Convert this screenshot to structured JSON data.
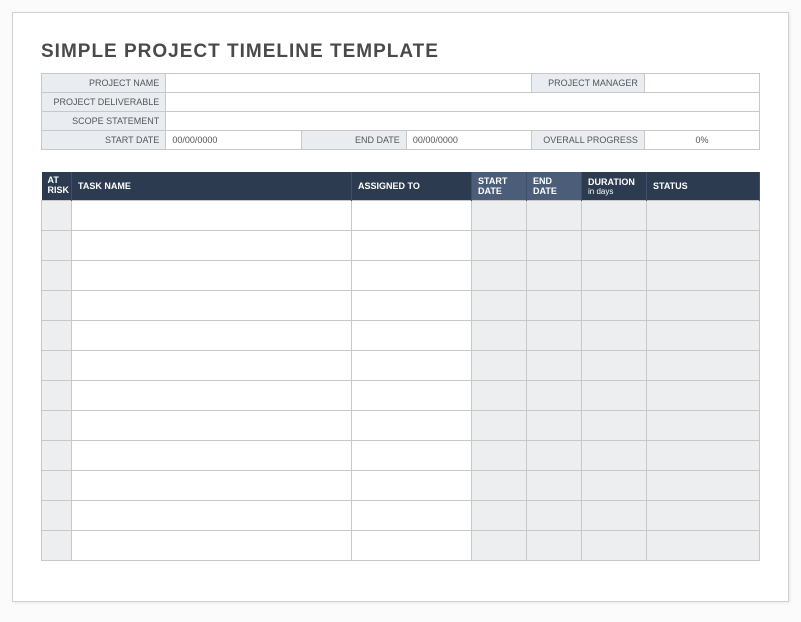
{
  "title": "SIMPLE PROJECT TIMELINE TEMPLATE",
  "info": {
    "project_name_label": "PROJECT NAME",
    "project_name_value": "",
    "project_manager_label": "PROJECT MANAGER",
    "project_manager_value": "",
    "deliverable_label": "PROJECT DELIVERABLE",
    "deliverable_value": "",
    "scope_label": "SCOPE STATEMENT",
    "scope_value": "",
    "start_date_label": "START DATE",
    "start_date_value": "00/00/0000",
    "end_date_label": "END DATE",
    "end_date_value": "00/00/0000",
    "progress_label": "OVERALL PROGRESS",
    "progress_value": "0%"
  },
  "task_headers": {
    "at_risk": "AT RISK",
    "task_name": "TASK NAME",
    "assigned_to": "ASSIGNED TO",
    "start_date": "START DATE",
    "end_date": "END DATE",
    "duration": "DURATION",
    "duration_sub": "in days",
    "status": "STATUS"
  },
  "task_rows": [
    {
      "at_risk": "",
      "task_name": "",
      "assigned_to": "",
      "start_date": "",
      "end_date": "",
      "duration": "",
      "status": ""
    },
    {
      "at_risk": "",
      "task_name": "",
      "assigned_to": "",
      "start_date": "",
      "end_date": "",
      "duration": "",
      "status": ""
    },
    {
      "at_risk": "",
      "task_name": "",
      "assigned_to": "",
      "start_date": "",
      "end_date": "",
      "duration": "",
      "status": ""
    },
    {
      "at_risk": "",
      "task_name": "",
      "assigned_to": "",
      "start_date": "",
      "end_date": "",
      "duration": "",
      "status": ""
    },
    {
      "at_risk": "",
      "task_name": "",
      "assigned_to": "",
      "start_date": "",
      "end_date": "",
      "duration": "",
      "status": ""
    },
    {
      "at_risk": "",
      "task_name": "",
      "assigned_to": "",
      "start_date": "",
      "end_date": "",
      "duration": "",
      "status": ""
    },
    {
      "at_risk": "",
      "task_name": "",
      "assigned_to": "",
      "start_date": "",
      "end_date": "",
      "duration": "",
      "status": ""
    },
    {
      "at_risk": "",
      "task_name": "",
      "assigned_to": "",
      "start_date": "",
      "end_date": "",
      "duration": "",
      "status": ""
    },
    {
      "at_risk": "",
      "task_name": "",
      "assigned_to": "",
      "start_date": "",
      "end_date": "",
      "duration": "",
      "status": ""
    },
    {
      "at_risk": "",
      "task_name": "",
      "assigned_to": "",
      "start_date": "",
      "end_date": "",
      "duration": "",
      "status": ""
    },
    {
      "at_risk": "",
      "task_name": "",
      "assigned_to": "",
      "start_date": "",
      "end_date": "",
      "duration": "",
      "status": ""
    },
    {
      "at_risk": "",
      "task_name": "",
      "assigned_to": "",
      "start_date": "",
      "end_date": "",
      "duration": "",
      "status": ""
    }
  ]
}
